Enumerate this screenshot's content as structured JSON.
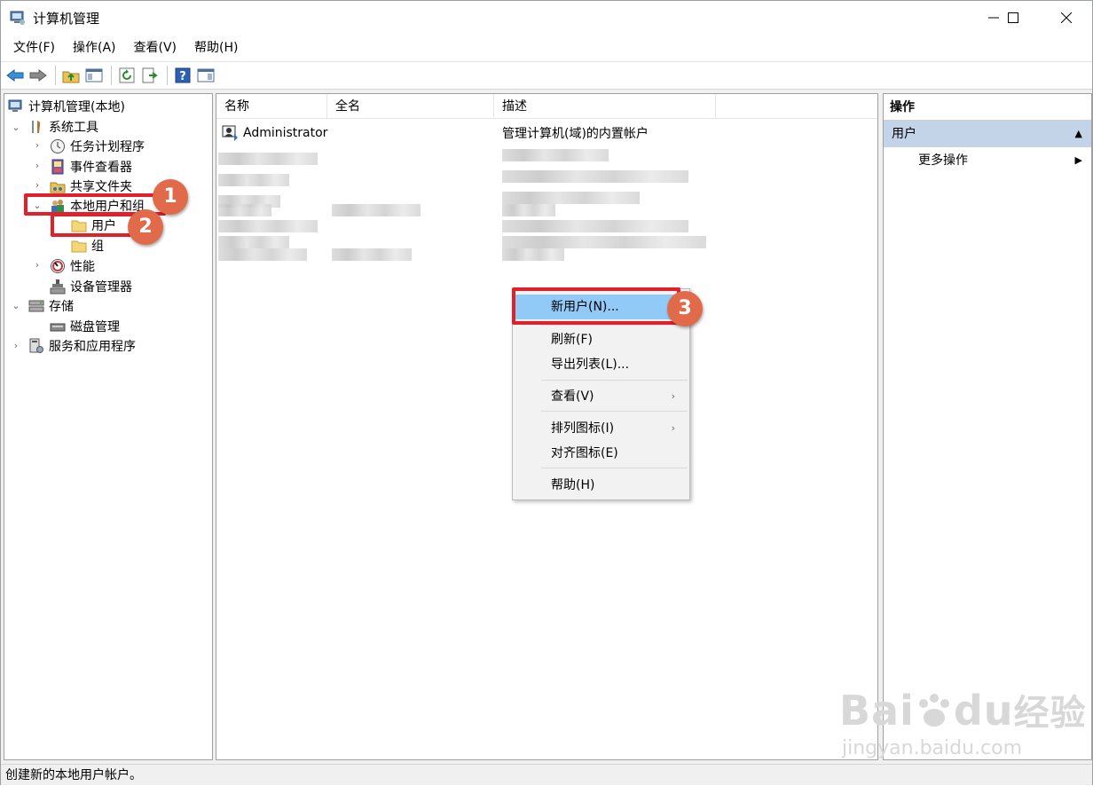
{
  "window": {
    "title": "计算机管理"
  },
  "menu": [
    "文件(F)",
    "操作(A)",
    "查看(V)",
    "帮助(H)"
  ],
  "tree": {
    "root": "计算机管理(本地)",
    "items": [
      {
        "label": "系统工具",
        "expander": "expanded"
      },
      {
        "label": "任务计划程序",
        "expander": "collapsed"
      },
      {
        "label": "事件查看器",
        "expander": "collapsed"
      },
      {
        "label": "共享文件夹",
        "expander": "collapsed"
      },
      {
        "label": "本地用户和组",
        "expander": "expanded"
      },
      {
        "label": "用户",
        "expander": "none"
      },
      {
        "label": "组",
        "expander": "none"
      },
      {
        "label": "性能",
        "expander": "collapsed"
      },
      {
        "label": "设备管理器",
        "expander": "none"
      },
      {
        "label": "存储",
        "expander": "expanded"
      },
      {
        "label": "磁盘管理",
        "expander": "none"
      },
      {
        "label": "服务和应用程序",
        "expander": "collapsed"
      }
    ]
  },
  "list": {
    "columns": [
      "名称",
      "全名",
      "描述"
    ],
    "rows": [
      {
        "name": "Administrator",
        "fullname": "",
        "description": "管理计算机(域)的内置帐户"
      }
    ]
  },
  "actions": {
    "header": "操作",
    "section": "用户",
    "more": "更多操作"
  },
  "context_menu": {
    "items": [
      "新用户(N)...",
      "刷新(F)",
      "导出列表(L)...",
      "查看(V)",
      "排列图标(I)",
      "对齐图标(E)",
      "帮助(H)"
    ],
    "highlighted": "新用户(N)..."
  },
  "annotations": {
    "badges": [
      "1",
      "2",
      "3"
    ]
  },
  "status": "创建新的本地用户帐户。",
  "watermark": {
    "brand_a": "Bai",
    "brand_b": "du",
    "brand_c": "经验",
    "url": "jingyan.baidu.com"
  },
  "colors": {
    "selection": "#c3d3e8",
    "menu_highlight": "#91c9f7",
    "annotation_red": "#e0202a",
    "badge": "#e06a4a"
  }
}
